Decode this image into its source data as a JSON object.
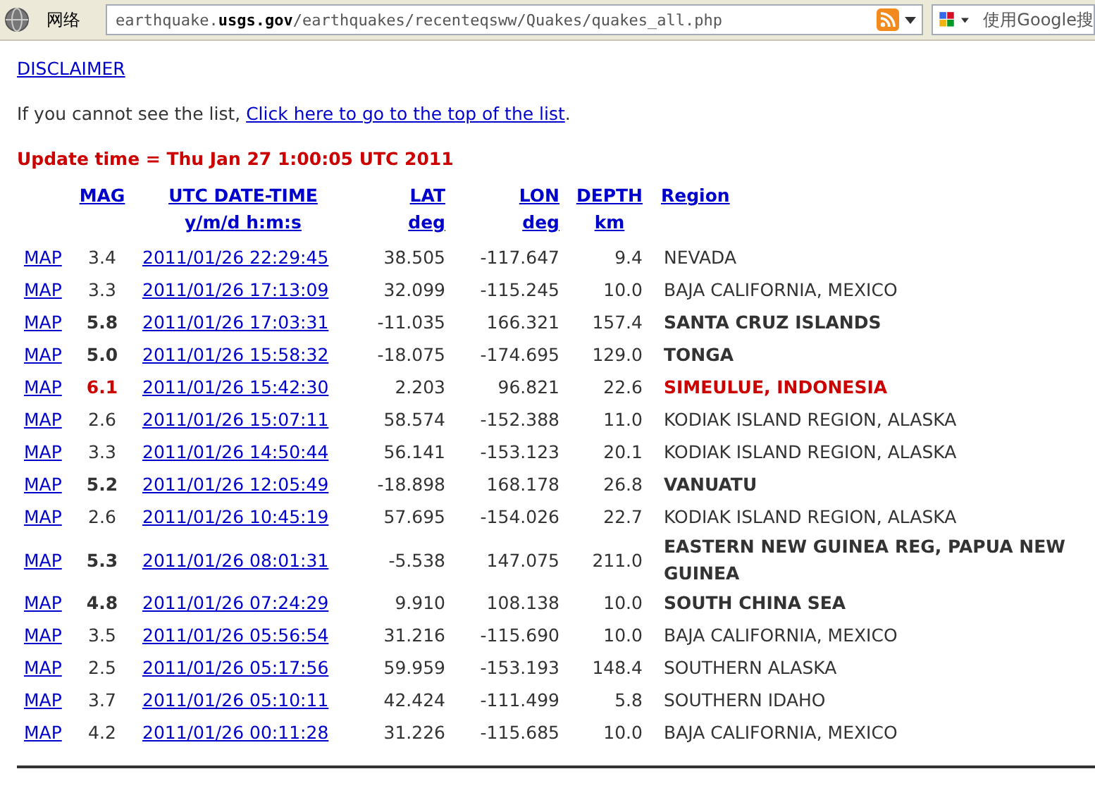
{
  "toolbar": {
    "network_label": "网络",
    "address": "earthquake.**usgs.gov**/earthquakes/recenteqsww/Quakes/quakes_all.php",
    "search_placeholder": "使用Google搜"
  },
  "page": {
    "disclaimer": "DISCLAIMER",
    "intro": "If you cannot see the list,",
    "intro_link": "Click here to go to the top of the list",
    "intro_end": ".",
    "update_time": "Update time = Thu Jan 27 1:00:05 UTC 2011"
  },
  "table": {
    "columns": [
      {
        "title": "MAG"
      },
      {
        "title": "UTC DATE-TIME",
        "unit": "y/m/d h:m:s"
      },
      {
        "title": "LAT",
        "unit": "deg"
      },
      {
        "title": "LON",
        "unit": "deg"
      },
      {
        "title": "DEPTH",
        "unit": "km"
      },
      {
        "title": "Region"
      }
    ],
    "rows": [
      {
        "map": "MAP",
        "mag": "3.4",
        "time": "2011/01/26 22:29:45",
        "lat": "38.505",
        "lon": "-117.647",
        "depth": "9.4",
        "region": "NEVADA",
        "kind": "minor"
      },
      {
        "map": "MAP",
        "mag": "3.3",
        "time": "2011/01/26 17:13:09",
        "lat": "32.099",
        "lon": "-115.245",
        "depth": "10.0",
        "region": "BAJA CALIFORNIA, MEXICO",
        "kind": "minor"
      },
      {
        "map": "MAP",
        "mag": "5.8",
        "time": "2011/01/26 17:03:31",
        "lat": "-11.035",
        "lon": "166.321",
        "depth": "157.4",
        "region": "SANTA CRUZ ISLANDS",
        "kind": "strong"
      },
      {
        "map": "MAP",
        "mag": "5.0",
        "time": "2011/01/26 15:58:32",
        "lat": "-18.075",
        "lon": "-174.695",
        "depth": "129.0",
        "region": "TONGA",
        "kind": "strong"
      },
      {
        "map": "MAP",
        "mag": "6.1",
        "time": "2011/01/26 15:42:30",
        "lat": "2.203",
        "lon": "96.821",
        "depth": "22.6",
        "region": "SIMEULUE, INDONESIA",
        "kind": "major"
      },
      {
        "map": "MAP",
        "mag": "2.6",
        "time": "2011/01/26 15:07:11",
        "lat": "58.574",
        "lon": "-152.388",
        "depth": "11.0",
        "region": "KODIAK ISLAND REGION, ALASKA",
        "kind": "minor"
      },
      {
        "map": "MAP",
        "mag": "3.3",
        "time": "2011/01/26 14:50:44",
        "lat": "56.141",
        "lon": "-153.123",
        "depth": "20.1",
        "region": "KODIAK ISLAND REGION, ALASKA",
        "kind": "minor"
      },
      {
        "map": "MAP",
        "mag": "5.2",
        "time": "2011/01/26 12:05:49",
        "lat": "-18.898",
        "lon": "168.178",
        "depth": "26.8",
        "region": "VANUATU",
        "kind": "strong"
      },
      {
        "map": "MAP",
        "mag": "2.6",
        "time": "2011/01/26 10:45:19",
        "lat": "57.695",
        "lon": "-154.026",
        "depth": "22.7",
        "region": "KODIAK ISLAND REGION, ALASKA",
        "kind": "minor"
      },
      {
        "map": "MAP",
        "mag": "5.3",
        "time": "2011/01/26 08:01:31",
        "lat": "-5.538",
        "lon": "147.075",
        "depth": "211.0",
        "region": "EASTERN NEW GUINEA REG, PAPUA NEW GUINEA",
        "kind": "strong"
      },
      {
        "map": "MAP",
        "mag": "4.8",
        "time": "2011/01/26 07:24:29",
        "lat": "9.910",
        "lon": "108.138",
        "depth": "10.0",
        "region": "SOUTH CHINA SEA",
        "kind": "strong"
      },
      {
        "map": "MAP",
        "mag": "3.5",
        "time": "2011/01/26 05:56:54",
        "lat": "31.216",
        "lon": "-115.690",
        "depth": "10.0",
        "region": "BAJA CALIFORNIA, MEXICO",
        "kind": "minor"
      },
      {
        "map": "MAP",
        "mag": "2.5",
        "time": "2011/01/26 05:17:56",
        "lat": "59.959",
        "lon": "-153.193",
        "depth": "148.4",
        "region": "SOUTHERN ALASKA",
        "kind": "minor"
      },
      {
        "map": "MAP",
        "mag": "3.7",
        "time": "2011/01/26 05:10:11",
        "lat": "42.424",
        "lon": "-111.499",
        "depth": "5.8",
        "region": "SOUTHERN IDAHO",
        "kind": "minor"
      },
      {
        "map": "MAP",
        "mag": "4.2",
        "time": "2011/01/26 00:11:28",
        "lat": "31.226",
        "lon": "-115.685",
        "depth": "10.0",
        "region": "BAJA CALIFORNIA, MEXICO",
        "kind": "minor"
      }
    ]
  }
}
